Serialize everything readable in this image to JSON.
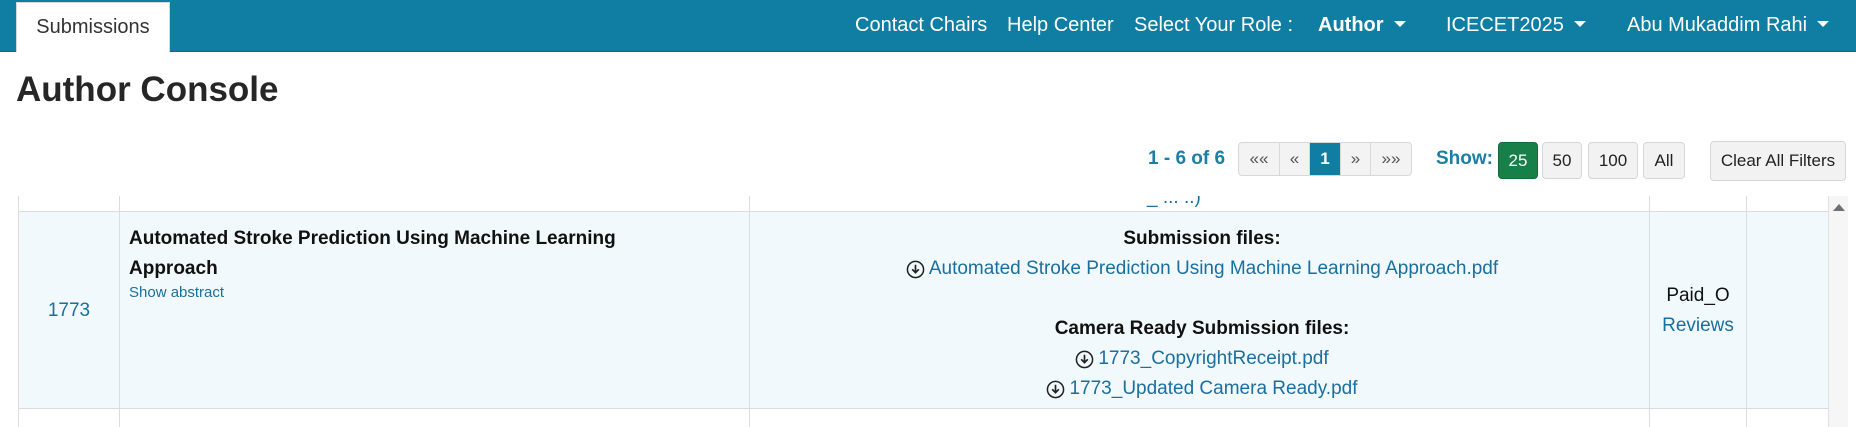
{
  "navbar": {
    "active_tab": "Submissions",
    "contact_chairs": "Contact Chairs",
    "help_center": "Help Center",
    "select_role_label": "Select Your Role :",
    "role": "Author",
    "conference": "ICECET2025",
    "user": "Abu Mukaddim Rahi",
    "bar_color": "#0f7ea2"
  },
  "page": {
    "title": "Author Console"
  },
  "pagination": {
    "range_text": "1 - 6 of 6",
    "first": "««",
    "prev": "«",
    "current": "1",
    "next": "»",
    "last": "»»",
    "show_label": "Show:",
    "page_sizes": [
      "25",
      "50",
      "100",
      "All"
    ],
    "active_page_size": "25",
    "clear_filters": "Clear All Filters"
  },
  "table": {
    "rows": [
      {
        "id": "1773",
        "title_line1": "Automated Stroke Prediction Using Machine Learning",
        "title_line2": "Approach",
        "show_abstract": "Show abstract",
        "submission_files_heading": "Submission files:",
        "submission_files": [
          "Automated Stroke Prediction Using Machine Learning Approach.pdf"
        ],
        "camera_ready_heading": "Camera Ready Submission files:",
        "camera_ready_files": [
          "1773_CopyrightReceipt.pdf",
          "1773_Updated Camera Ready.pdf"
        ],
        "status": "Paid_O",
        "reviews": "Reviews"
      }
    ]
  },
  "colors": {
    "link": "#1a6fa0",
    "accent": "#1a7fa6",
    "active_page_size": "#178048",
    "row_highlight": "#f1f9fc"
  },
  "icons": {
    "download": "download-circle-icon",
    "caret": "chevron-down-icon",
    "scroll_up": "scroll-up-arrow-icon"
  }
}
